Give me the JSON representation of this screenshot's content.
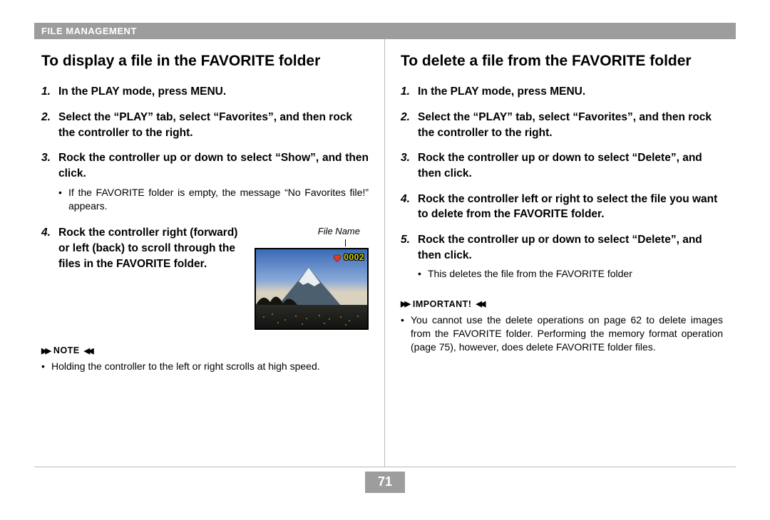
{
  "header": "File Management",
  "page_number": "71",
  "left": {
    "title": "To display a file in the FAVORITE folder",
    "steps": [
      {
        "n": "1.",
        "text": "In the PLAY mode, press MENU."
      },
      {
        "n": "2.",
        "text": "Select the “PLAY” tab, select “Favorites”, and then rock the controller to the right."
      },
      {
        "n": "3.",
        "text": "Rock the controller up or down to select “Show”, and then click.",
        "bullet": "If the FAVORITE folder is empty, the message “No Favorites file!” appears."
      },
      {
        "n": "4.",
        "text": "Rock the controller right (forward) or left (back) to scroll through the files in the FAVORITE folder."
      }
    ],
    "image_caption": "File Name",
    "image_overlay_filename": "0002",
    "note_label": "Note",
    "note_text": "Holding the controller to the left or right scrolls at high speed."
  },
  "right": {
    "title": "To delete a file from the FAVORITE folder",
    "steps": [
      {
        "n": "1.",
        "text": "In the PLAY mode, press MENU."
      },
      {
        "n": "2.",
        "text": "Select the “PLAY” tab, select “Favorites”, and then rock the controller to the right."
      },
      {
        "n": "3.",
        "text": "Rock the controller up or down to select “Delete”, and then click."
      },
      {
        "n": "4.",
        "text": "Rock the controller left or right to select the file you want to delete from the FAVORITE folder."
      },
      {
        "n": "5.",
        "text": "Rock the controller up or down to select “Delete”, and then click.",
        "bullet": "This deletes the file from the FAVORITE folder"
      }
    ],
    "important_label": "Important!",
    "important_text": "You cannot use the delete operations on page 62 to delete images from the FAVORITE folder. Performing the memory format operation (page 75), however, does delete FAVORITE folder files."
  }
}
